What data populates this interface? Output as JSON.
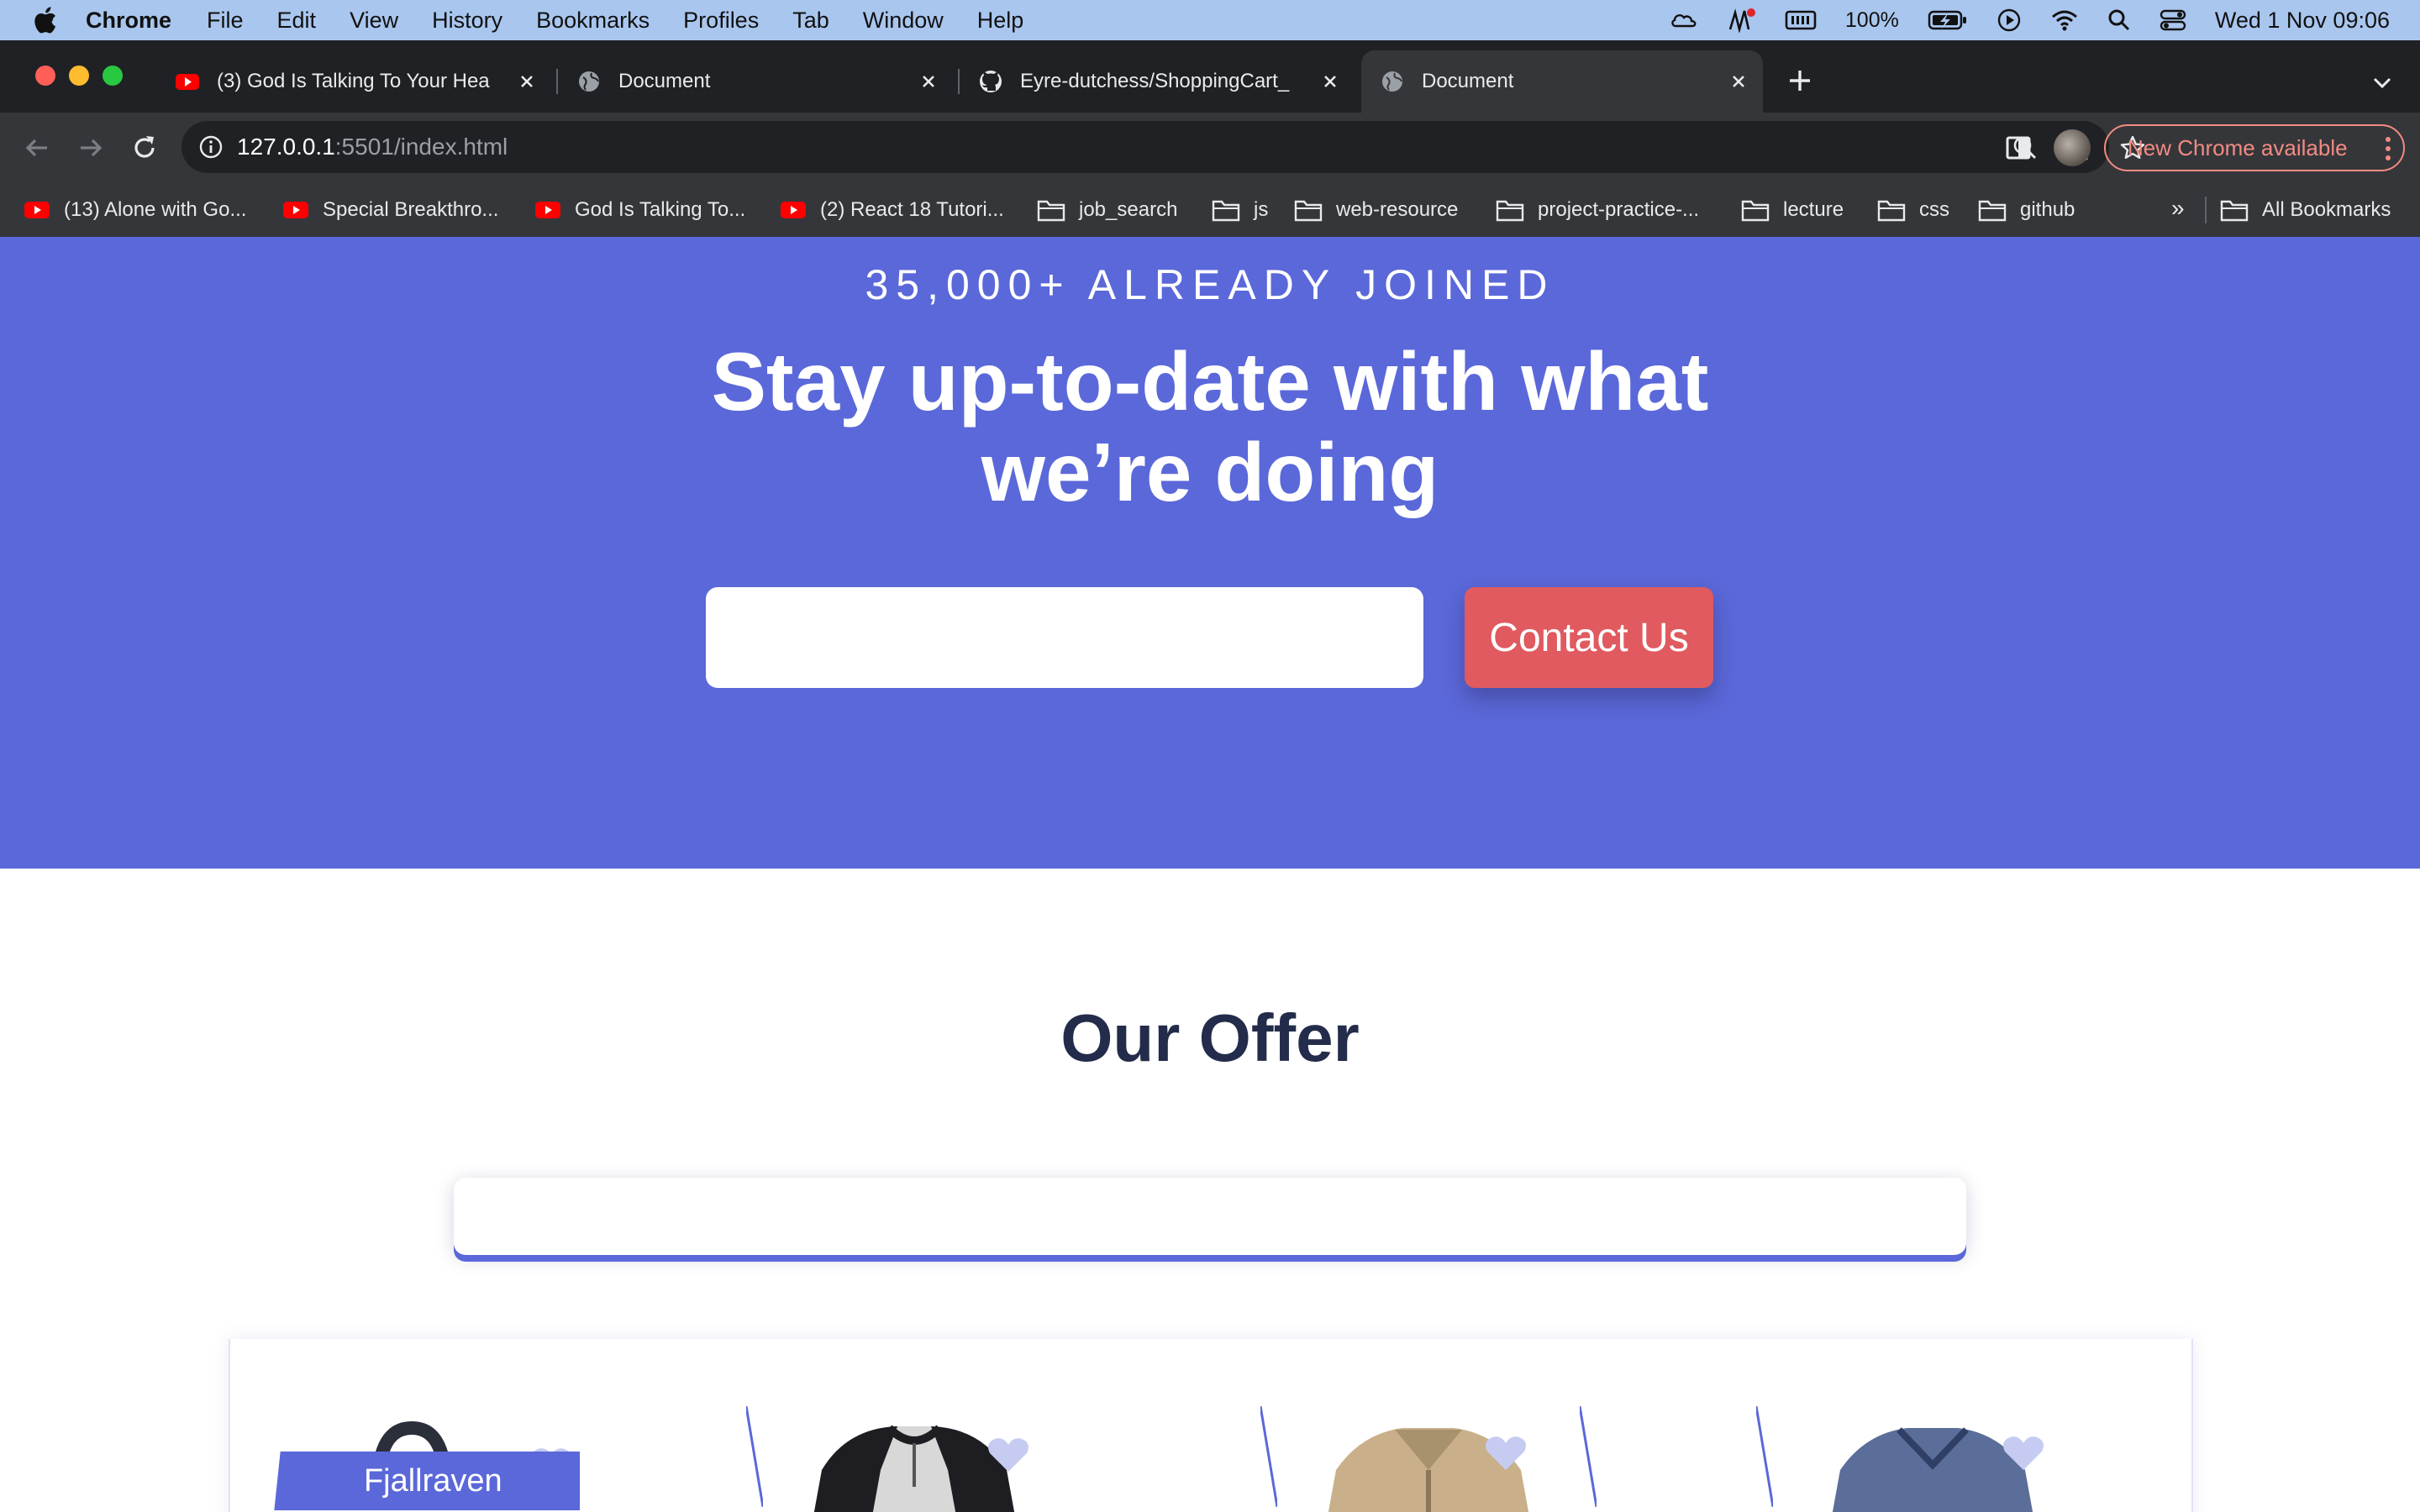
{
  "menubar": {
    "app_name": "Chrome",
    "items": [
      "File",
      "Edit",
      "View",
      "History",
      "Bookmarks",
      "Profiles",
      "Tab",
      "Window",
      "Help"
    ],
    "battery_percent": "100%",
    "clock": "Wed 1 Nov  09:06"
  },
  "tabs": [
    {
      "title": "(3) God Is Talking To Your Hea",
      "icon": "youtube-icon",
      "active": false
    },
    {
      "title": "Document",
      "icon": "globe-icon",
      "active": false
    },
    {
      "title": "Eyre-dutchess/ShoppingCart_",
      "icon": "github-icon",
      "active": false
    },
    {
      "title": "Document",
      "icon": "globe-icon",
      "active": true
    }
  ],
  "address_bar": {
    "host": "127.0.0.1",
    "path": ":5501/index.html"
  },
  "update_button": "New Chrome available",
  "bookmarks": [
    {
      "label": "(13) Alone with Go...",
      "icon": "youtube-icon"
    },
    {
      "label": "Special Breakthro...",
      "icon": "youtube-icon"
    },
    {
      "label": "God Is Talking To...",
      "icon": "youtube-icon"
    },
    {
      "label": "(2) React 18 Tutori...",
      "icon": "youtube-icon"
    },
    {
      "label": "job_search",
      "icon": "folder-icon"
    },
    {
      "label": "js",
      "icon": "folder-icon"
    },
    {
      "label": "web-resource",
      "icon": "folder-icon"
    },
    {
      "label": "project-practice-...",
      "icon": "folder-icon"
    },
    {
      "label": "lecture",
      "icon": "folder-icon"
    },
    {
      "label": "css",
      "icon": "folder-icon"
    },
    {
      "label": "github",
      "icon": "folder-icon"
    }
  ],
  "bookmarks_overflow": "»",
  "all_bookmarks": "All Bookmarks",
  "hero": {
    "eyebrow": "35,000+ ALREADY JOINED",
    "headline": "Stay up-to-date with what we’re doing",
    "email_value": "",
    "contact_button": "Contact Us"
  },
  "offer": {
    "title": "Our Offer",
    "products": [
      {
        "brand": "Fjallraven",
        "item_icon": "backpack-icon"
      },
      {
        "item_icon": "raglan-shirt-icon"
      },
      {
        "item_icon": "jacket-icon"
      },
      {
        "item_icon": "vneck-shirt-icon"
      }
    ]
  },
  "colors": {
    "hero_bg": "#5b68d9",
    "contact_button": "#e05a5f",
    "section_title": "#232c4a",
    "menubar_bg": "#a9c6ee",
    "chrome_dark": "#202124",
    "chrome_toolbar": "#35363a",
    "update_accent": "#f28b82"
  }
}
